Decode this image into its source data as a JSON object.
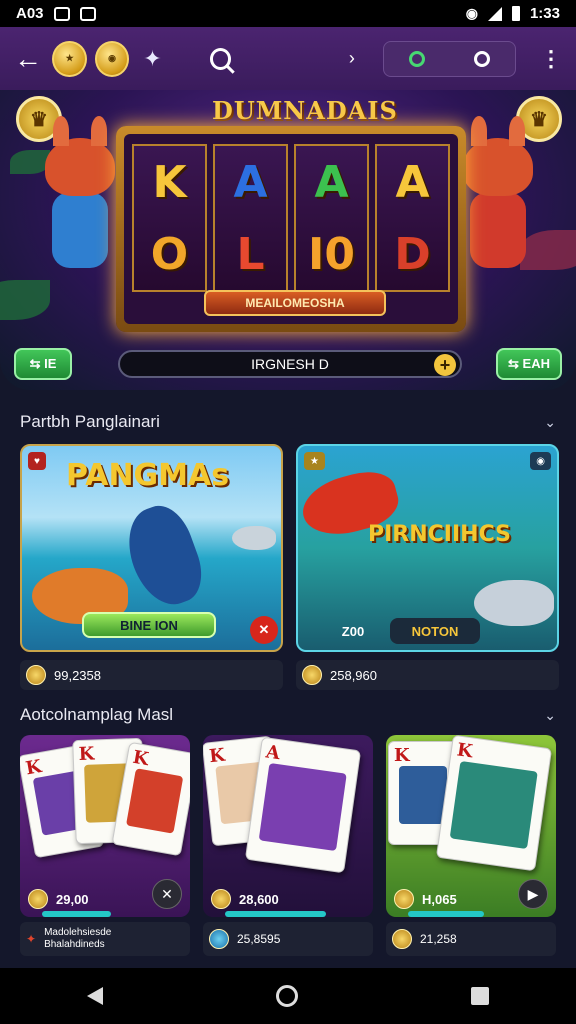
{
  "status_bar": {
    "left_text": "A03",
    "time": "1:33"
  },
  "top_bar": {
    "back_glyph": "←",
    "coin1": "★",
    "coin2": "◉",
    "spark_glyph": "✦",
    "chevron_glyph": "›",
    "more_glyph": "⋮"
  },
  "hero": {
    "title": "DUMNADAIS",
    "reels_top": [
      "K",
      "A",
      "A",
      "A"
    ],
    "reels_bottom": [
      "O",
      "L",
      "I0",
      "D"
    ],
    "reel_top_colors": [
      "#f6c63b",
      "#2c6fe0",
      "#3cc04f",
      "#f6c63b"
    ],
    "reel_bottom_colors": [
      "#f1a62a",
      "#e8492f",
      "#f5a22c",
      "#d9402a"
    ],
    "marquee": "MEAILOMEOSHA",
    "left_button": "⇆ IE",
    "progress_text": "IRGNESH D",
    "progress_plus": "+",
    "right_button": "⇆ EAH"
  },
  "section1": {
    "title": "Partbh Panglainari",
    "chevron": "⌄"
  },
  "fish_games": [
    {
      "title": "PANGMAs",
      "button": "BINE ION",
      "amount": "99,2358",
      "tag": ""
    },
    {
      "title": "PIRNCIIHCS",
      "stat": "Z00",
      "button": "NOTON",
      "amount": "258,960",
      "tag": ""
    }
  ],
  "section2": {
    "title": "Aotcolnamplag Masl",
    "chevron": "⌄"
  },
  "card_games": [
    {
      "amount": "29,00",
      "action": "✕",
      "sub1": "Madolehsiesde",
      "sub2": "Bhalahdineds",
      "bar_fill": 0.55
    },
    {
      "amount": "28,600",
      "sub": "25,8595",
      "bar_fill": 0.8
    },
    {
      "amount": "H,065",
      "action": "▶",
      "sub": "21,258",
      "bar_fill": 0.6
    }
  ]
}
